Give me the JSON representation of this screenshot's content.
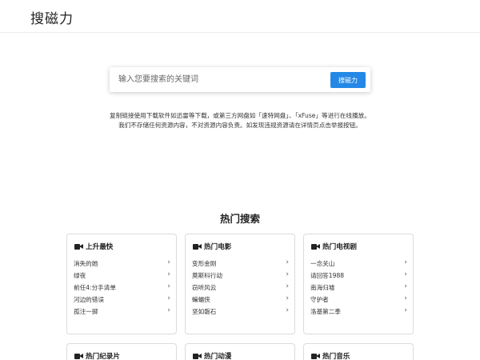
{
  "header": {
    "logo": "搜磁力"
  },
  "search": {
    "placeholder": "输入您要搜索的关键词",
    "button_label": "搜磁力"
  },
  "notice": {
    "line1": "复制链接使用下载软件如迅雷等下载，或第三方网盘如「速特网盘」、「xFuse」等进行在线播放。",
    "line2": "我们不存储任何资源内容，不对资源内容负责。如发现违规资源请在详情页点击举报按钮。"
  },
  "hot": {
    "title": "热门搜索",
    "cards": [
      {
        "title": "上升最快",
        "items": [
          "消失的她",
          "绿夜",
          "前任4:分手清单",
          "河边的错误",
          "孤注一掷"
        ]
      },
      {
        "title": "热门电影",
        "items": [
          "变形金刚",
          "莫斯科行动",
          "窃听风云",
          "蝙蝠侠",
          "坚如磐石"
        ]
      },
      {
        "title": "热门电视剧",
        "items": [
          "一念关山",
          "请回答1988",
          "南海归墟",
          "守护者",
          "洛基第二季"
        ]
      },
      {
        "title": "热门纪录片",
        "items": []
      },
      {
        "title": "热门动漫",
        "items": []
      },
      {
        "title": "热门音乐",
        "items": []
      }
    ]
  },
  "icons": {
    "card_icon": "video-camera-icon",
    "item_icon": "chevron-right-icon"
  },
  "colors": {
    "accent": "#2588e6"
  }
}
